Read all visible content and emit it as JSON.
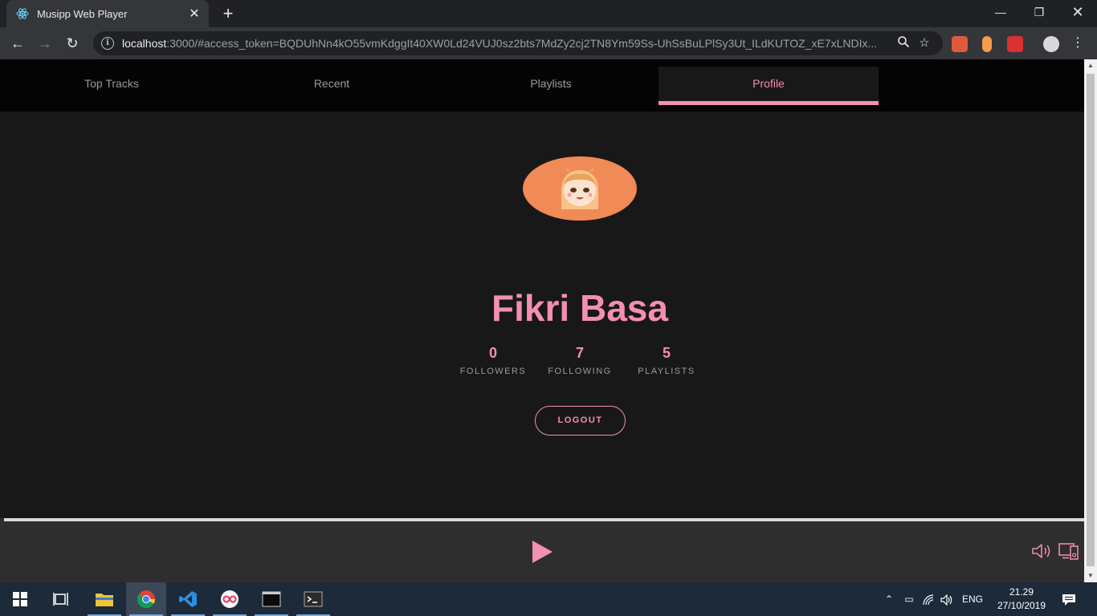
{
  "browser": {
    "tab_title": "Musipp Web Player",
    "url_host": "localhost",
    "url_rest": ":3000/#access_token=BQDUhNn4kO55vmKdggIt40XW0Ld24VUJ0sz2bts7MdZy2cj2TN8Ym59Ss-UhSsBuLPlSy3Ut_ILdKUTOZ_xE7xLNDIx..."
  },
  "nav": {
    "tabs": [
      {
        "label": "Top Tracks"
      },
      {
        "label": "Recent"
      },
      {
        "label": "Playlists"
      },
      {
        "label": "Profile"
      }
    ],
    "active": "Profile"
  },
  "profile": {
    "name": "Fikri Basa",
    "stats": [
      {
        "value": "0",
        "label": "FOLLOWERS"
      },
      {
        "value": "7",
        "label": "FOLLOWING"
      },
      {
        "value": "5",
        "label": "PLAYLISTS"
      }
    ],
    "logout_label": "LOGOUT"
  },
  "taskbar": {
    "language": "ENG",
    "time": "21.29",
    "date": "27/10/2019"
  },
  "colors": {
    "accent": "#f48fb1",
    "background": "#181818",
    "nav_background": "#040404",
    "avatar_background": "#f08a56"
  }
}
